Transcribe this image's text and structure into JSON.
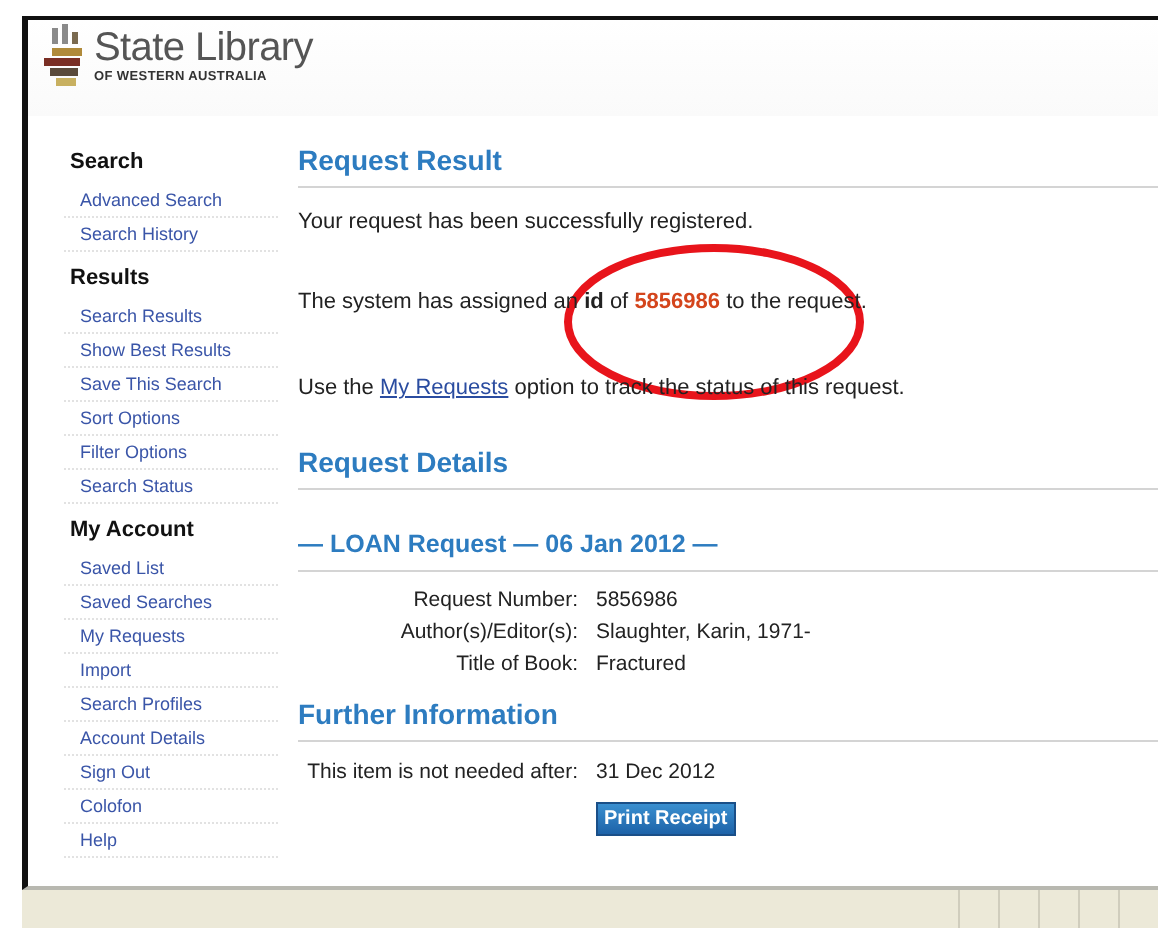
{
  "logo": {
    "title": "State Library",
    "subtitle": "OF WESTERN AUSTRALIA"
  },
  "sidebar": [
    {
      "heading": "Search",
      "items": [
        "Advanced Search",
        "Search History"
      ]
    },
    {
      "heading": "Results",
      "items": [
        "Search Results",
        "Show Best Results",
        "Save This Search",
        "Sort Options",
        "Filter Options",
        "Search Status"
      ]
    },
    {
      "heading": "My Account",
      "items": [
        "Saved List",
        "Saved Searches",
        "My Requests",
        "Import",
        "Search Profiles",
        "Account Details",
        "Sign Out",
        "Colofon",
        "Help"
      ]
    }
  ],
  "request_result": {
    "heading": "Request Result",
    "message": "Your request has been successfully registered.",
    "assigned": {
      "before": "The system has assigned an",
      "bold": "id",
      "middle": "of",
      "number": "5856986",
      "after": "to the request."
    },
    "usage": {
      "before": "Use the",
      "link": "My Requests",
      "after": "option to track the status of this request."
    }
  },
  "request_details": {
    "heading": "Request Details",
    "loan_heading": "— LOAN Request — 06 Jan 2012 —",
    "fields": [
      {
        "label": "Request Number:",
        "value": "5856986"
      },
      {
        "label": "Author(s)/Editor(s):",
        "value": "Slaughter, Karin, 1971-"
      },
      {
        "label": "Title of Book:",
        "value": "Fractured"
      }
    ]
  },
  "further_information": {
    "heading": "Further Information",
    "fields": [
      {
        "label": "This item is not needed after:",
        "value": "31 Dec 2012"
      }
    ],
    "button": "Print Receipt"
  }
}
